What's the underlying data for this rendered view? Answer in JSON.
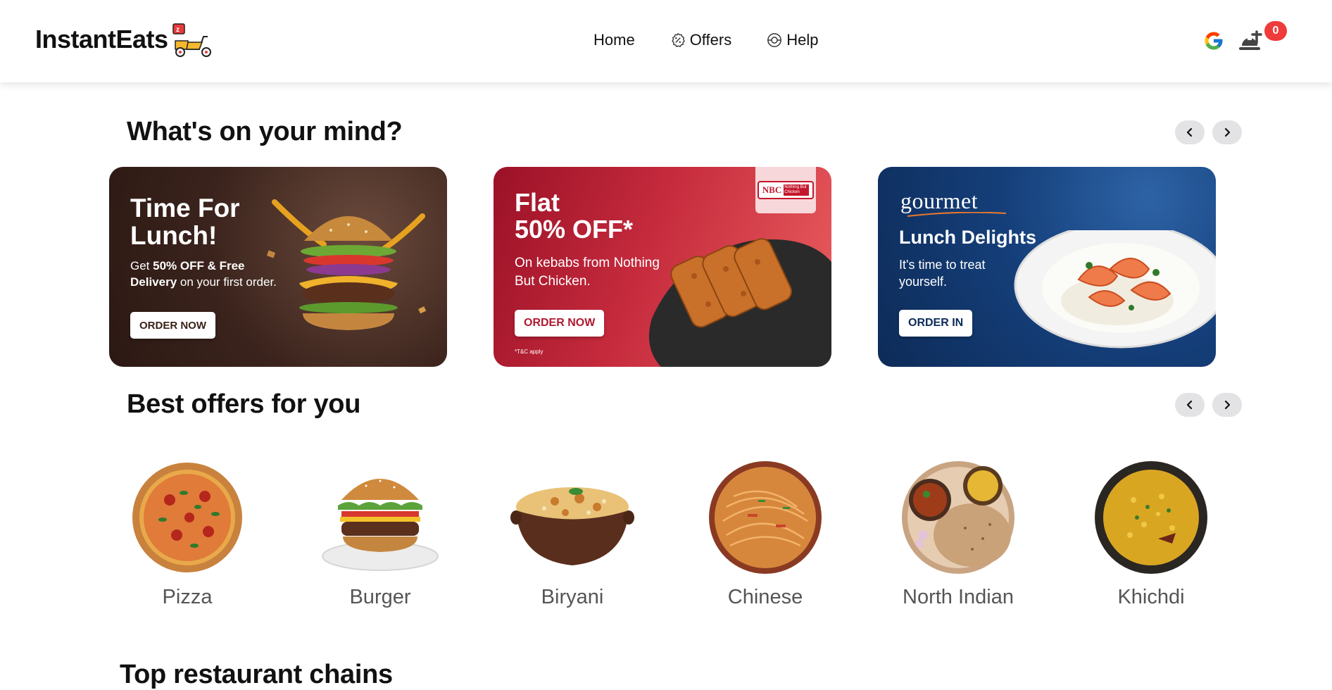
{
  "brand": {
    "name": "InstantEats"
  },
  "nav": {
    "home": "Home",
    "offers": "Offers",
    "help": "Help"
  },
  "cart": {
    "count": "0"
  },
  "sections": {
    "mind": "What's on your mind?",
    "offers": "Best offers for you",
    "chains": "Top restaurant chains"
  },
  "banners": [
    {
      "title_line1": "Time For",
      "title_line2": "Lunch!",
      "sub_pre": "Get ",
      "sub_bold": "50% OFF & Free Delivery",
      "sub_post": " on your first order.",
      "button": "ORDER NOW"
    },
    {
      "title_line1": "Flat",
      "title_line2": "50% OFF*",
      "sub": "On kebabs from Nothing But Chicken.",
      "button": "ORDER NOW",
      "tnc": "*T&C apply",
      "badge_main": "NBC",
      "badge_side": "Nothing But Chicken"
    },
    {
      "brand": "gourmet",
      "title": "Lunch Delights",
      "sub": "It's time to treat yourself.",
      "button": "ORDER IN"
    }
  ],
  "offers": [
    {
      "label": "Pizza"
    },
    {
      "label": "Burger"
    },
    {
      "label": "Biryani"
    },
    {
      "label": "Chinese"
    },
    {
      "label": "North Indian"
    },
    {
      "label": "Khichdi"
    }
  ],
  "colors": {
    "badge": "#ef3b3b",
    "banner1_btn_text": "#3a2219",
    "banner2_btn_text": "#b01a2f",
    "banner3_btn_text": "#0d2b58"
  }
}
